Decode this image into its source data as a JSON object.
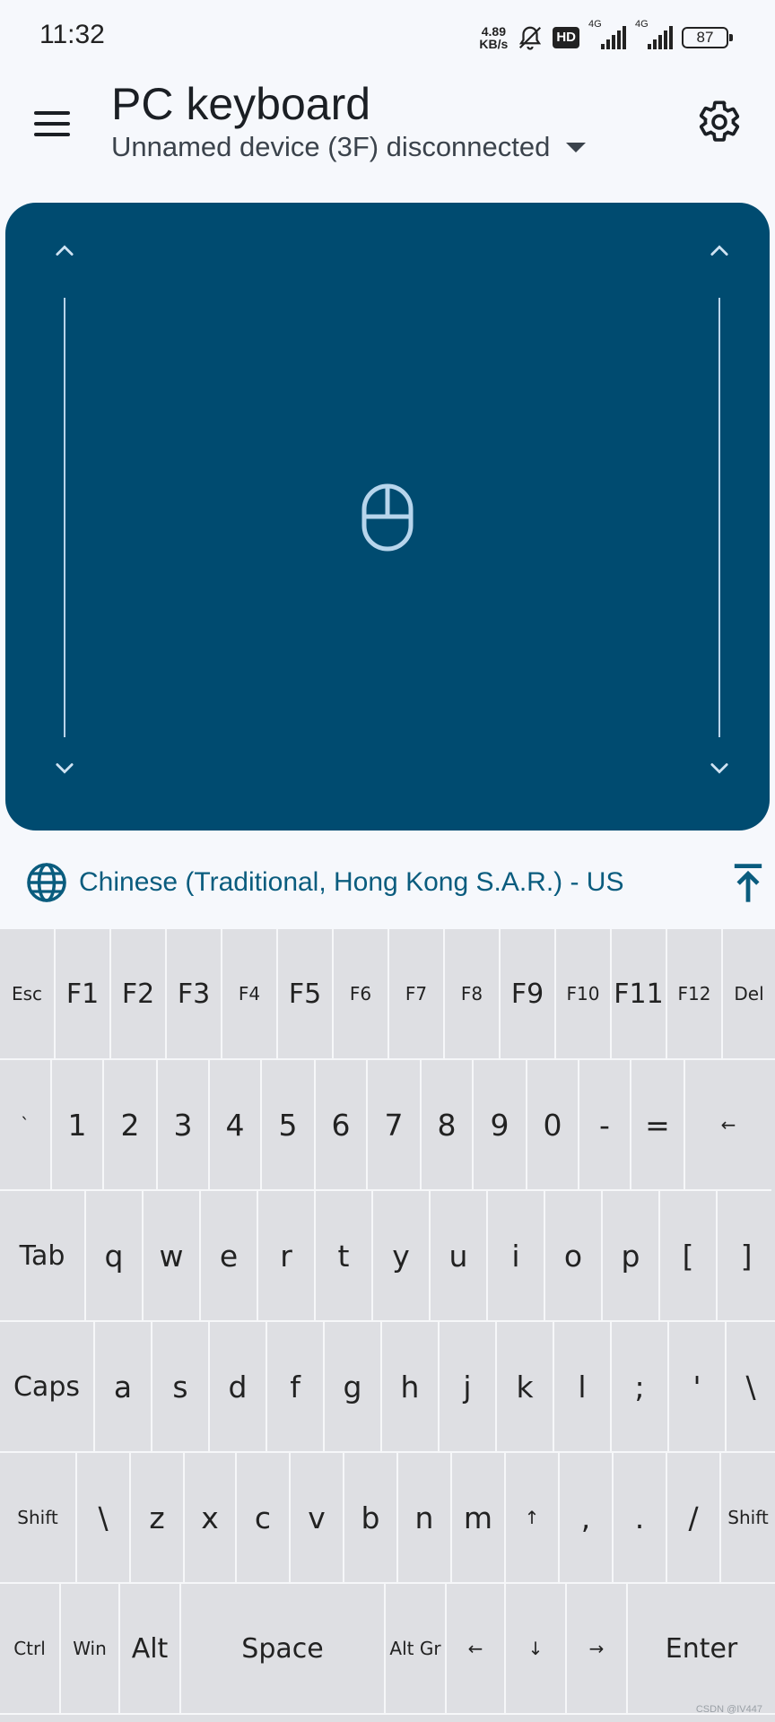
{
  "status_bar": {
    "time": "11:32",
    "net_speed_value": "4.89",
    "net_speed_unit": "KB/s",
    "hd_label": "HD",
    "signal1_label": "4G",
    "signal2_label": "4G",
    "battery": "87"
  },
  "app_bar": {
    "title": "PC keyboard",
    "device_status": "Unnamed device (3F) disconnected"
  },
  "language": {
    "label": "Chinese (Traditional, Hong Kong S.A.R.) - US"
  },
  "keyboard": {
    "rows": [
      [
        "Esc",
        "F1",
        "F2",
        "F3",
        "F4",
        "F5",
        "F6",
        "F7",
        "F8",
        "F9",
        "F10",
        "F11",
        "F12",
        "Del"
      ],
      [
        "`",
        "1",
        "2",
        "3",
        "4",
        "5",
        "6",
        "7",
        "8",
        "9",
        "0",
        "-",
        "=",
        "←"
      ],
      [
        "Tab",
        "q",
        "w",
        "e",
        "r",
        "t",
        "y",
        "u",
        "i",
        "o",
        "p",
        "[",
        "]"
      ],
      [
        "Caps",
        "a",
        "s",
        "d",
        "f",
        "g",
        "h",
        "j",
        "k",
        "l",
        ";",
        "'",
        "\\"
      ],
      [
        "Shift",
        "\\",
        "z",
        "x",
        "c",
        "v",
        "b",
        "n",
        "m",
        "↑",
        ",",
        ".",
        "/",
        "Shift"
      ],
      [
        "Ctrl",
        "Win",
        "Alt",
        "Space",
        "Alt Gr",
        "←",
        "↓",
        "→",
        "Enter"
      ]
    ]
  },
  "watermark": "CSDN @IV447"
}
